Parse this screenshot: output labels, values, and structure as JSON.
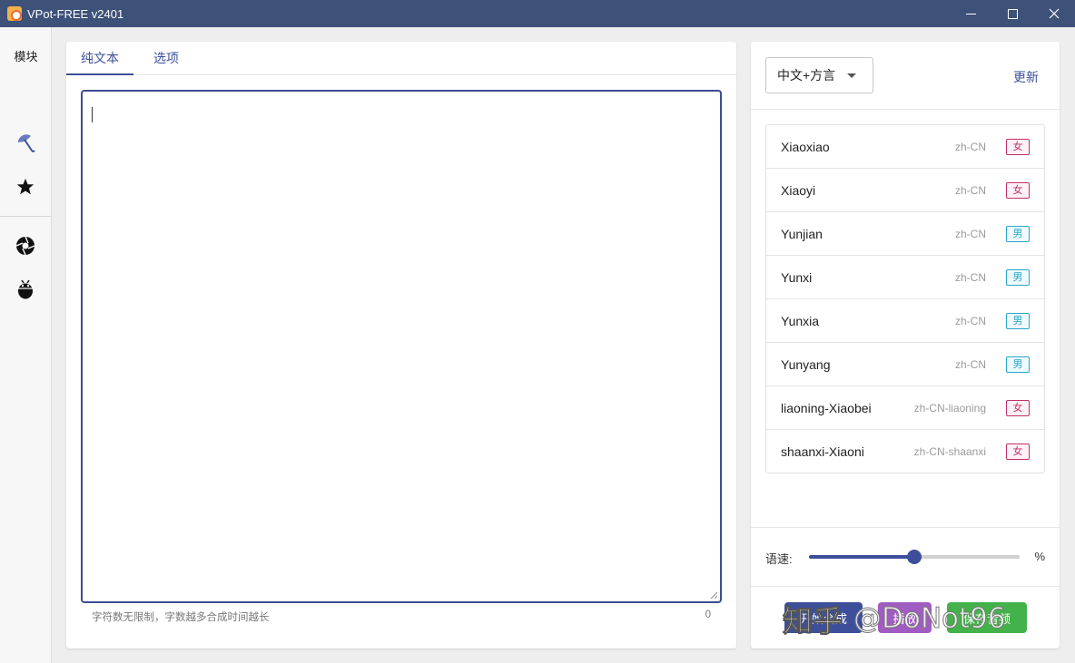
{
  "window": {
    "title": "VPot-FREE v2401",
    "controls": {
      "minimize": "—",
      "maximize": "☐",
      "close": "✕"
    }
  },
  "leftnav": {
    "title": "模块",
    "items": [
      {
        "icon": "umbrella-icon"
      },
      {
        "icon": "star-icon"
      },
      {
        "icon": "aperture-icon"
      },
      {
        "icon": "bug-icon"
      }
    ]
  },
  "main": {
    "tabs": [
      {
        "label": "纯文本",
        "active": true
      },
      {
        "label": "选项",
        "active": false
      }
    ],
    "editor": {
      "value": ""
    },
    "hint": "字符数无限制，字数越多合成时间越长",
    "char_count": "0"
  },
  "voice_panel": {
    "language_select": {
      "value": "中文+方言"
    },
    "update_label": "更新",
    "voices": [
      {
        "name": "Xiaoxiao",
        "locale": "zh-CN",
        "gender": "女",
        "gender_type": "female"
      },
      {
        "name": "Xiaoyi",
        "locale": "zh-CN",
        "gender": "女",
        "gender_type": "female"
      },
      {
        "name": "Yunjian",
        "locale": "zh-CN",
        "gender": "男",
        "gender_type": "male"
      },
      {
        "name": "Yunxi",
        "locale": "zh-CN",
        "gender": "男",
        "gender_type": "male"
      },
      {
        "name": "Yunxia",
        "locale": "zh-CN",
        "gender": "男",
        "gender_type": "male"
      },
      {
        "name": "Yunyang",
        "locale": "zh-CN",
        "gender": "男",
        "gender_type": "male"
      },
      {
        "name": "liaoning-Xiaobei",
        "locale": "zh-CN-liaoning",
        "gender": "女",
        "gender_type": "female"
      },
      {
        "name": "shaanxi-Xiaoni",
        "locale": "zh-CN-shaanxi",
        "gender": "女",
        "gender_type": "female"
      }
    ],
    "speed": {
      "label": "语速:",
      "unit": "%",
      "level_percent": 50
    },
    "buttons": {
      "synthesize": "开始合成",
      "play": "播放",
      "save": "保存音频"
    }
  },
  "watermark": {
    "site": "知乎",
    "handle": "@DoNot96"
  },
  "colors": {
    "titlebar": "#3d5179",
    "accent": "#3d4f9a",
    "female_tag": "#c0306a",
    "male_tag": "#27a7c9",
    "play_button": "#a05cc0",
    "save_button": "#43b24a"
  }
}
